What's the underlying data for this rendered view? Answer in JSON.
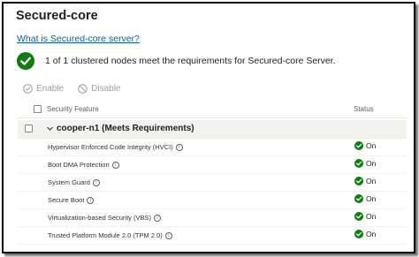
{
  "page": {
    "title": "Secured-core",
    "link": "What is Secured-core server?",
    "summary": "1 of 1 clustered nodes meet the requirements for Secured-core Server."
  },
  "toolbar": {
    "enable_label": "Enable",
    "disable_label": "Disable"
  },
  "table": {
    "columns": {
      "feature": "Security Feature",
      "status": "Status"
    },
    "group": {
      "label": "cooper-n1 (Meets Requirements)"
    },
    "rows": [
      {
        "feature": "Hypervisor Enforced Code Integrity (HVCI)",
        "status": "On"
      },
      {
        "feature": "Boot DMA Protection",
        "status": "On"
      },
      {
        "feature": "System Guard",
        "status": "On"
      },
      {
        "feature": "Secure Boot",
        "status": "On"
      },
      {
        "feature": "Virtualization-based Security (VBS)",
        "status": "On"
      },
      {
        "feature": "Trusted Platform Module 2.0 (TPM 2.0)",
        "status": "On"
      }
    ]
  },
  "colors": {
    "success": "#107c10",
    "link": "#0b5cad",
    "disabled": "#a19f9d"
  },
  "icons": {
    "summary": "success-check-icon",
    "enable": "check-circle-icon",
    "disable": "block-icon",
    "status": "success-check-icon",
    "info": "info-icon",
    "expand": "chevron-down-icon"
  }
}
